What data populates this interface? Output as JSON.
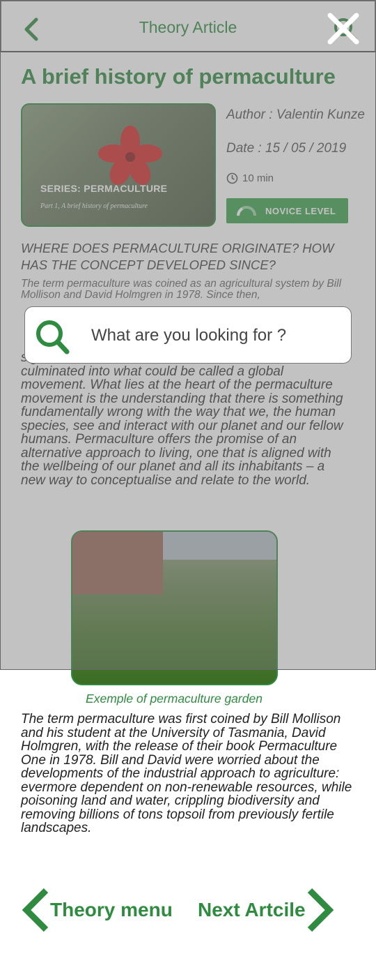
{
  "header": {
    "title": "Theory Article"
  },
  "article": {
    "title": "A brief history of permaculture",
    "hero": {
      "series": "SERIES: PERMACULTURE",
      "part": "Part 1, A brief history of permaculture"
    },
    "author": "Author : Valentin Kunze",
    "date": "Date : 15 / 05 / 2019",
    "duration": "10 min",
    "level": "NOVICE LEVEL",
    "question": " WHERE DOES PERMACULTURE ORIGINATE? HOW HAS THE CONCEPT DEVELOPED SINCE?",
    "paragraph_1": "The term permaculture was coined as an agricultural system by Bill Mollison and David Holmgren in 1978.  Since then,",
    "paragraph_2": "significant traction in the last two decades and has culminated into what could be called a global movement. What lies at the heart of the permaculture movement is the understanding that there is something fundamentally wrong with the way that we, the human species, see and interact with our planet and our fellow humans. Permaculture offers the promise of an alternative approach to living, one that is aligned with the wellbeing of our planet and all its inhabitants – a new way to conceptualise and relate to the world.",
    "image_caption": "Exemple of permaculture garden",
    "paragraph_3": "The term permaculture was first coined by Bill Mollison and his student at the University of Tasmania, David Holmgren, with the release of their book Permaculture One in 1978. Bill and David were worried about the developments of the industrial approach to agriculture: evermore dependent on non-renewable resources, while poisoning land and water, crippling biodiversity and removing billions of tons topsoil from previously fertile landscapes."
  },
  "search": {
    "placeholder": "What are you looking for ?"
  },
  "footer": {
    "prev_label": "Theory menu",
    "next_label": "Next Artcile"
  },
  "colors": {
    "accent": "#2e8b3f",
    "badge": "#3da34d",
    "overlay": "rgba(120,120,120,0.45)"
  },
  "icons": {
    "back": "chevron-left-icon",
    "header_search": "search-icon",
    "close": "close-icon",
    "clock": "clock-icon",
    "level": "gauge-icon",
    "search": "search-icon",
    "prev": "chevron-left-icon",
    "next": "chevron-right-icon"
  }
}
